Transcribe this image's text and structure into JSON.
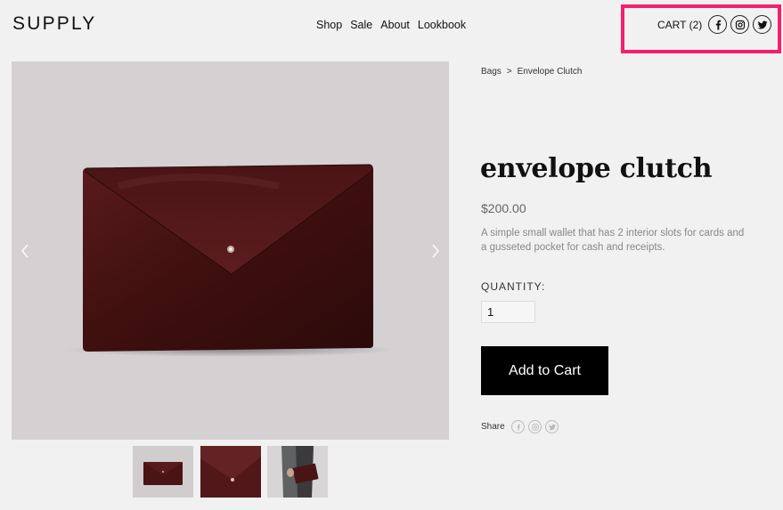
{
  "header": {
    "logo": "SUPPLY",
    "nav": [
      "Shop",
      "Sale",
      "About",
      "Lookbook"
    ],
    "cart_label": "CART (2)",
    "highlight_color": "#f31f6f",
    "social_icons": [
      "facebook-icon",
      "instagram-icon",
      "twitter-icon"
    ]
  },
  "breadcrumb": {
    "parent": "Bags",
    "separator": ">",
    "current": "Envelope Clutch"
  },
  "product": {
    "title": "envelope clutch",
    "price": "$200.00",
    "description": "A simple small wallet that has 2 interior slots for cards and a gusseted pocket for cash and receipts.",
    "quantity_label": "QUANTITY:",
    "quantity_value": "1",
    "add_to_cart_label": "Add to Cart",
    "share_label": "Share",
    "share_icons": [
      "facebook-icon",
      "instagram-icon",
      "twitter-icon"
    ]
  },
  "gallery": {
    "thumbnails": [
      "clutch-front",
      "clutch-closeup",
      "clutch-in-hand"
    ],
    "selected_index": 0
  }
}
